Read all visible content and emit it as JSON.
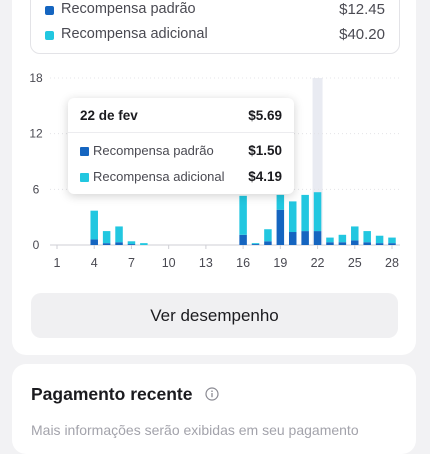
{
  "summary": {
    "rows": [
      {
        "label": "Recompensa padrão",
        "value": "$12.45",
        "color": "#1565c0"
      },
      {
        "label": "Recompensa adicional",
        "value": "$40.20",
        "color": "#22c7e0"
      }
    ]
  },
  "chart_data": {
    "type": "bar",
    "stacked": true,
    "x": [
      1,
      2,
      3,
      4,
      5,
      6,
      7,
      8,
      9,
      10,
      11,
      12,
      13,
      14,
      15,
      16,
      17,
      18,
      19,
      20,
      21,
      22,
      23,
      24,
      25,
      26,
      27,
      28
    ],
    "x_tick_labels": [
      "1",
      "4",
      "7",
      "10",
      "13",
      "16",
      "19",
      "22",
      "25",
      "28"
    ],
    "y_tick_labels": [
      "0",
      "6",
      "12",
      "18"
    ],
    "ylim": [
      0,
      18
    ],
    "highlighted_x": 22,
    "series": [
      {
        "name": "Recompensa padrão",
        "color": "#1565c0",
        "values": [
          0,
          0,
          0,
          0.6,
          0.2,
          0.3,
          0.1,
          0,
          0,
          0,
          0,
          0,
          0,
          0,
          0,
          1.1,
          0.1,
          0.4,
          3.8,
          1.4,
          1.5,
          1.5,
          0.3,
          0.3,
          0.5,
          0.3,
          0.2,
          0.2
        ]
      },
      {
        "name": "Recompensa adicional",
        "color": "#22c7e0",
        "values": [
          0,
          0,
          0,
          3.1,
          1.3,
          1.7,
          0.3,
          0.2,
          0,
          0,
          0,
          0,
          0,
          0,
          0,
          4.2,
          0.1,
          1.3,
          1.6,
          3.3,
          3.9,
          4.19,
          0.5,
          0.8,
          1.5,
          1.2,
          0.8,
          0.6
        ]
      }
    ]
  },
  "tooltip": {
    "date": "22 de fev",
    "total": "$5.69",
    "rows": [
      {
        "label": "Recompensa padrão",
        "value": "$1.50",
        "color": "#1565c0"
      },
      {
        "label": "Recompensa adicional",
        "value": "$4.19",
        "color": "#22c7e0"
      }
    ]
  },
  "performance_button": {
    "label": "Ver desempenho"
  },
  "payment": {
    "title": "Pagamento recente",
    "info_icon": "info-circle-icon",
    "description": "Mais informações serão exibidas em seu pagamento"
  }
}
